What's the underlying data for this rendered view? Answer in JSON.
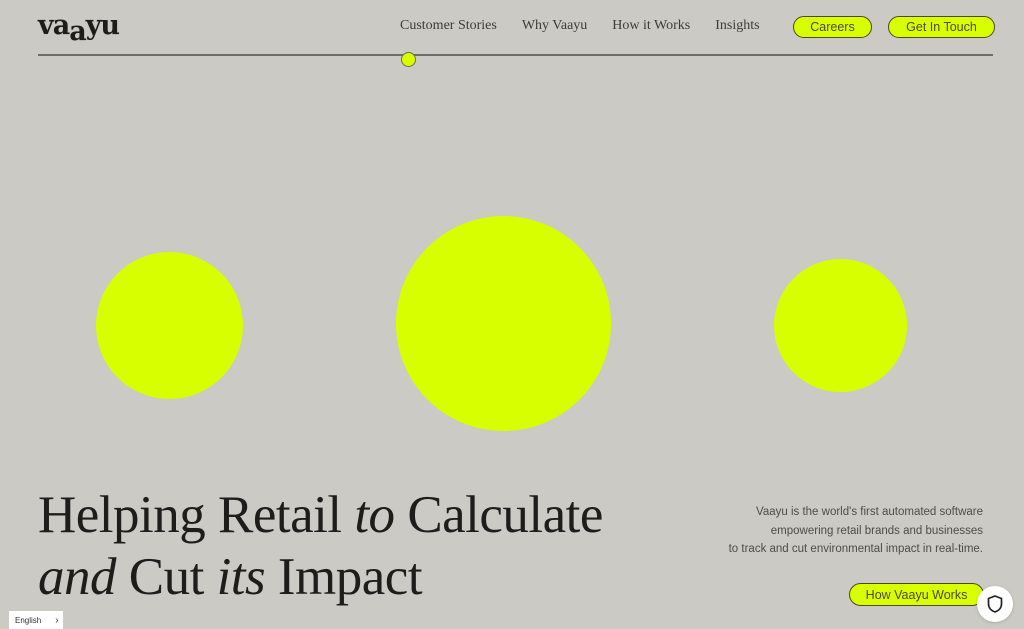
{
  "brand": {
    "logo_parts": [
      "va",
      "a",
      "yu"
    ],
    "accent_color": "#d8ff00",
    "background_color": "#cbcac4"
  },
  "nav": {
    "items": [
      {
        "label": "Customer Stories"
      },
      {
        "label": "Why Vaayu"
      },
      {
        "label": "How it Works"
      },
      {
        "label": "Insights"
      }
    ],
    "careers_label": "Careers",
    "contact_label": "Get In Touch"
  },
  "hero": {
    "headline_line1": {
      "a": "Helping Retail ",
      "b": "to",
      "c": " Calculate"
    },
    "headline_line2": {
      "a": "and",
      "b": " Cut ",
      "c": "its",
      "d": " Impact"
    },
    "description": [
      "Vaayu is the world's first automated software",
      "empowering retail brands and businesses",
      "to track and cut environmental impact in real-time."
    ],
    "cta_label": "How Vaayu Works"
  },
  "footer_widgets": {
    "language_label": "English",
    "shield_icon": "shield-icon"
  }
}
